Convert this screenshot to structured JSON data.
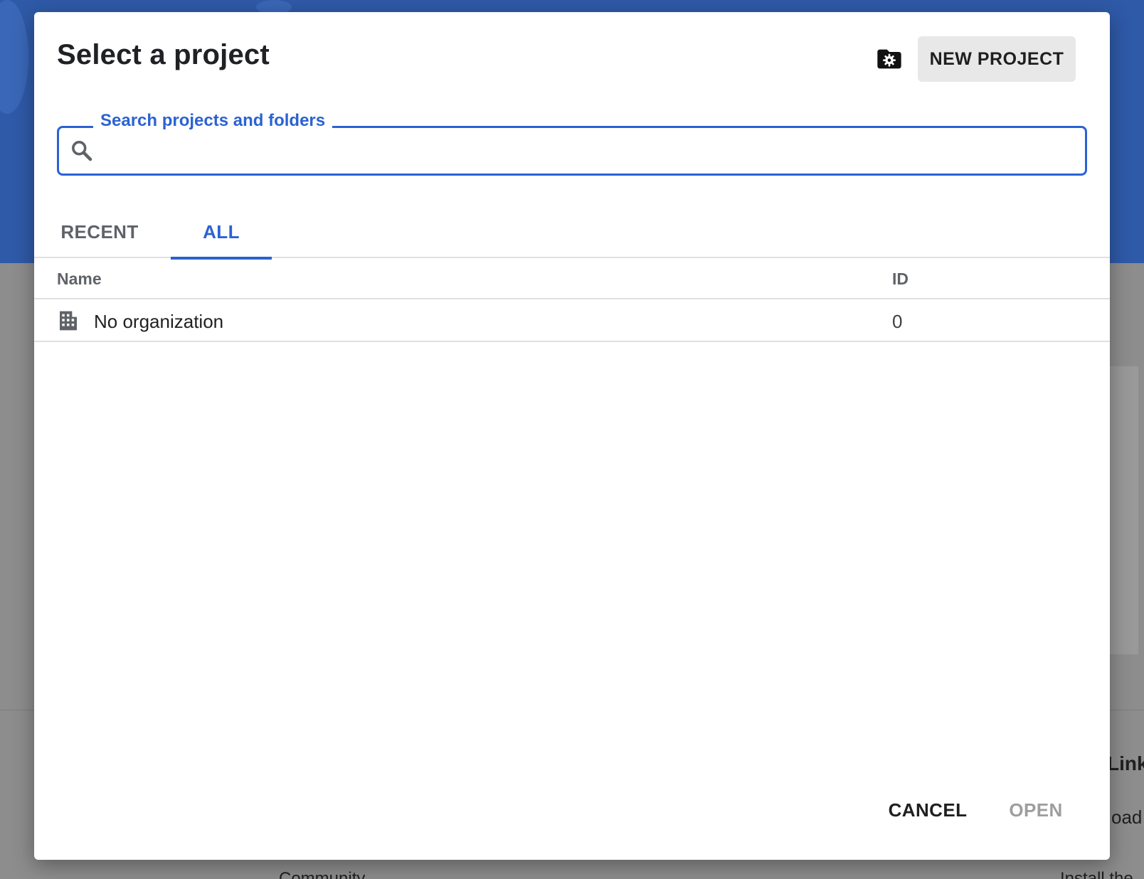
{
  "dialog": {
    "title": "Select a project",
    "new_project_label": "NEW PROJECT",
    "search": {
      "label": "Search projects and folders",
      "value": "",
      "placeholder": ""
    },
    "tabs": [
      {
        "label": "RECENT",
        "active": false
      },
      {
        "label": "ALL",
        "active": true
      }
    ],
    "table": {
      "columns": [
        "Name",
        "ID"
      ],
      "rows": [
        {
          "icon": "organization-icon",
          "name": "No organization",
          "id": "0"
        }
      ]
    },
    "footer": {
      "cancel_label": "CANCEL",
      "open_label": "OPEN"
    }
  },
  "background": {
    "partial_texts": [
      "Links",
      "oad",
      "Community",
      "Install the"
    ]
  },
  "colors": {
    "accent": "#2b62d3",
    "header_bg": "#2f5aa8"
  }
}
